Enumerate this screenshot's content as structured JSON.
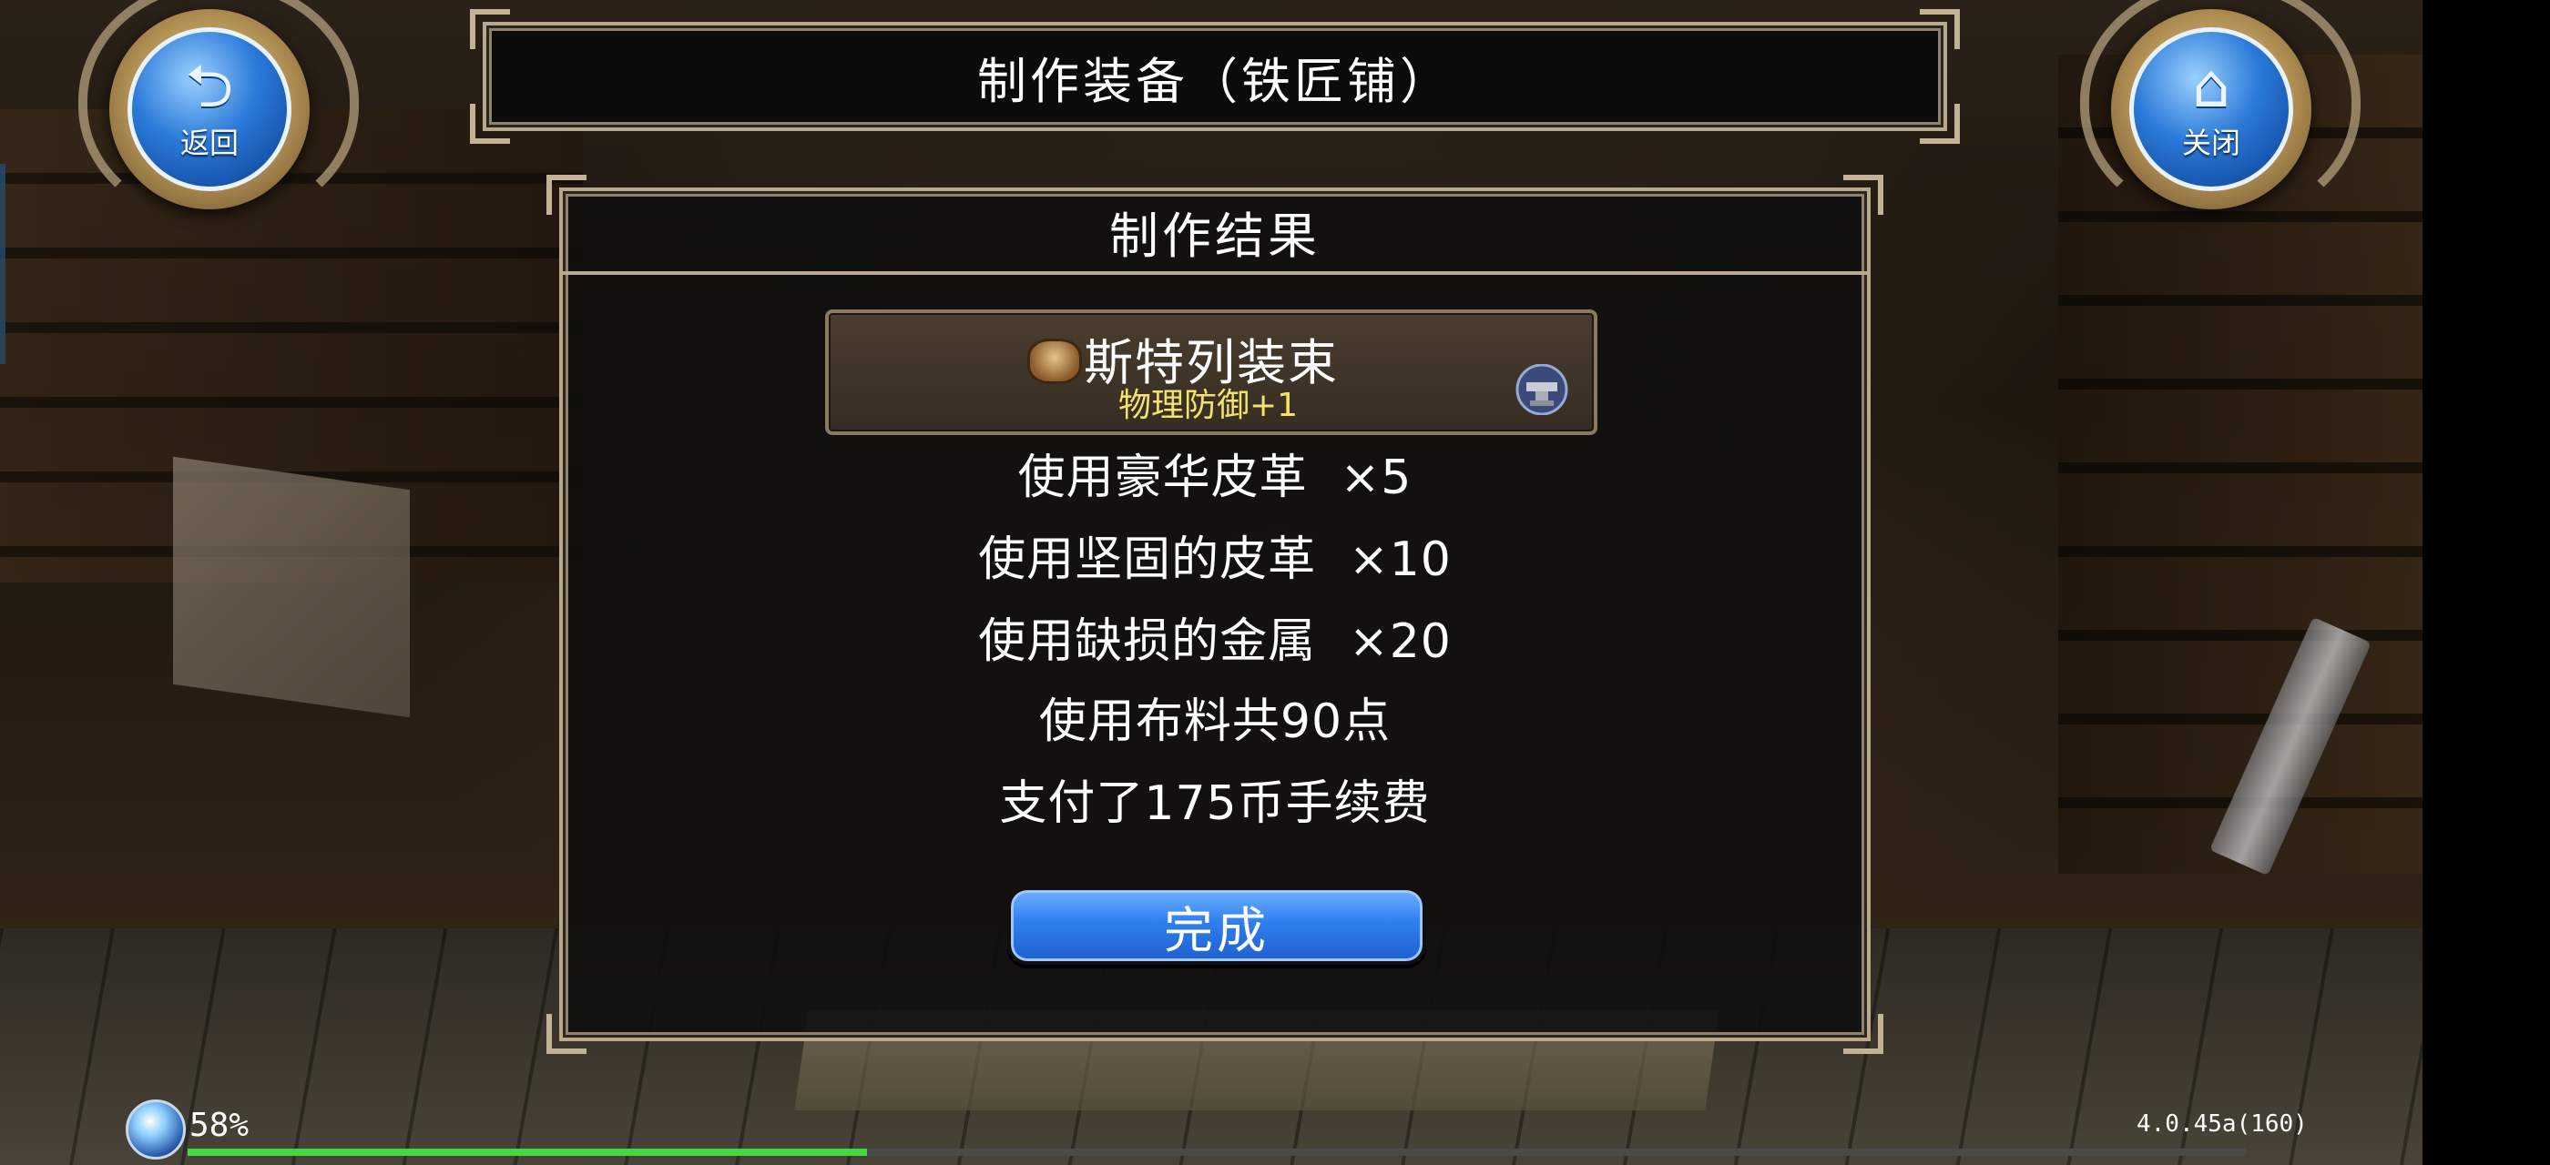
{
  "header": {
    "title": "制作装备（铁匠铺）",
    "back_label": "返回",
    "close_label": "关闭"
  },
  "result_panel": {
    "title": "制作结果",
    "item": {
      "name": "斯特列装束",
      "stat": "物理防御+1",
      "icon": "armor-icon",
      "craft_icon": "anvil-icon"
    },
    "lines": [
      {
        "text": "使用豪华皮革",
        "qty": "×5"
      },
      {
        "text": "使用坚固的皮革",
        "qty": "×10"
      },
      {
        "text": "使用缺损的金属",
        "qty": "×20"
      },
      {
        "text": "使用布料共90点",
        "qty": ""
      },
      {
        "text": "支付了175币手续费",
        "qty": ""
      }
    ],
    "done_label": "完成"
  },
  "status_bar": {
    "xp_percent_label": "58%",
    "xp_fraction": 0.33,
    "version": "4.0.45a(160)"
  },
  "colors": {
    "button_blue": "#2f7ff0",
    "stat_yellow": "#f2e46a",
    "frame_gold": "#b8a98e",
    "xp_green": "#44d644"
  }
}
